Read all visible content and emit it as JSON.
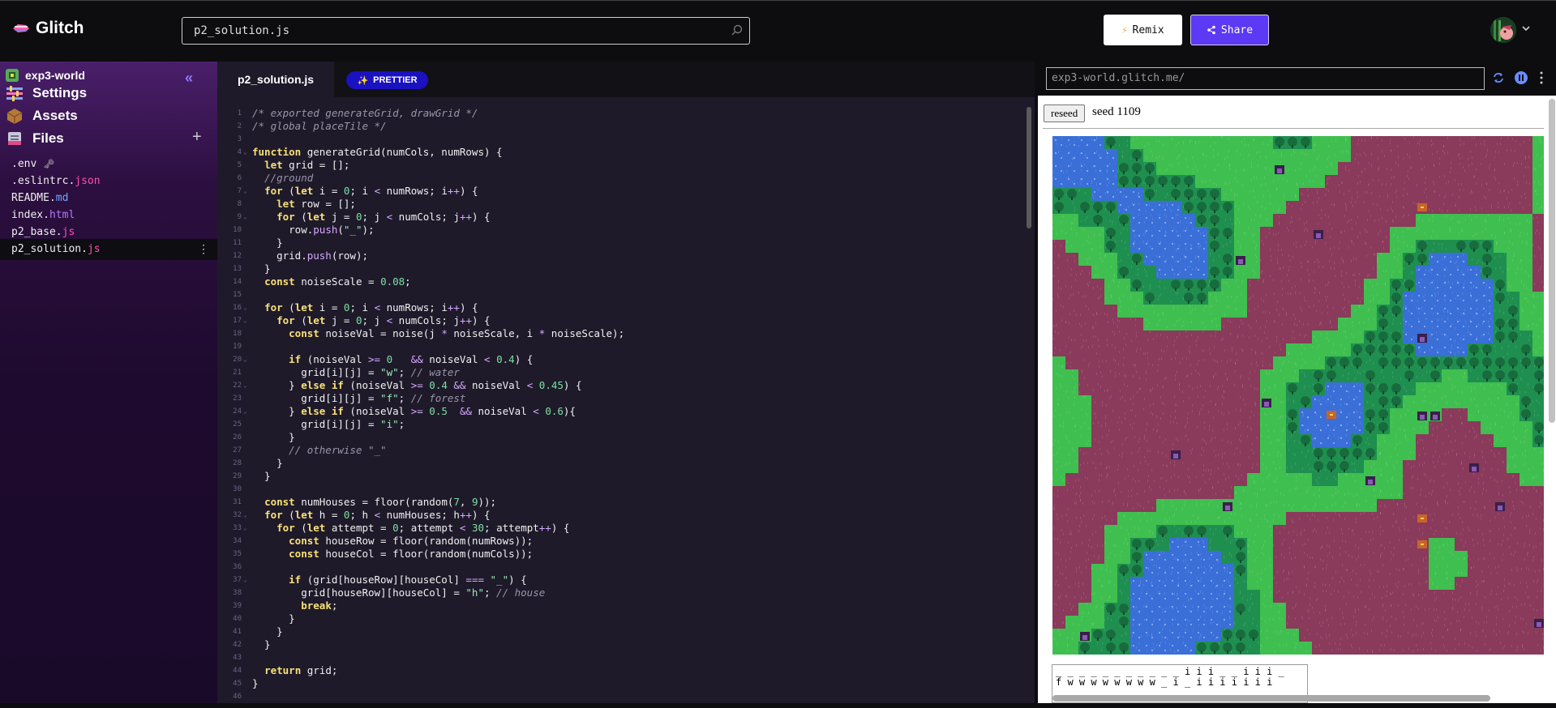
{
  "header": {
    "logo_text": "Glitch",
    "search_value": "p2_solution.js",
    "remix_label": "Remix",
    "share_label": "Share"
  },
  "sidebar": {
    "project_name": "exp3-world",
    "collapse_symbol": "«",
    "nav": {
      "settings": "Settings",
      "assets": "Assets",
      "files": "Files"
    },
    "add_symbol": "+",
    "files": [
      {
        "base": ".env",
        "ext": ""
      },
      {
        "base": ".eslintrc.",
        "ext": "json"
      },
      {
        "base": "README.",
        "ext": "md"
      },
      {
        "base": "index.",
        "ext": "html"
      },
      {
        "base": "p2_base.",
        "ext": "js"
      },
      {
        "base": "p2_solution.",
        "ext": "js"
      }
    ],
    "file_menu_symbol": "⋮"
  },
  "editor": {
    "tab_label": "p2_solution.js",
    "prettier_label": "PRETTIER",
    "line_numbers": [
      "1",
      "2",
      "3",
      "4",
      "5",
      "6",
      "7",
      "8",
      "9",
      "10",
      "11",
      "12",
      "13",
      "14",
      "15",
      "16",
      "17",
      "18",
      "19",
      "20",
      "21",
      "22",
      "23",
      "24",
      "25",
      "26",
      "27",
      "28",
      "29",
      "30",
      "31",
      "32",
      "33",
      "34",
      "35",
      "36",
      "37",
      "38",
      "39",
      "40",
      "41",
      "42",
      "43",
      "44",
      "45",
      "46"
    ],
    "code_lines": [
      [
        [
          "cm",
          "/* exported generateGrid, drawGrid */"
        ]
      ],
      [
        [
          "cm",
          "/* global placeTile */"
        ]
      ],
      [
        [
          "tx",
          ""
        ]
      ],
      [
        [
          "kw",
          "function"
        ],
        [
          "tx",
          " generateGrid(numCols, numRows) {"
        ]
      ],
      [
        [
          "tx",
          "  "
        ],
        [
          "kw",
          "let"
        ],
        [
          "tx",
          " grid = [];"
        ]
      ],
      [
        [
          "tx",
          "  "
        ],
        [
          "cm",
          "//ground"
        ]
      ],
      [
        [
          "tx",
          "  "
        ],
        [
          "kw",
          "for"
        ],
        [
          "tx",
          " ("
        ],
        [
          "kw",
          "let"
        ],
        [
          "tx",
          " i = "
        ],
        [
          "num",
          "0"
        ],
        [
          "tx",
          "; i "
        ],
        [
          "op",
          "<"
        ],
        [
          "tx",
          " numRows; i"
        ],
        [
          "op",
          "++"
        ],
        [
          "tx",
          ") {"
        ]
      ],
      [
        [
          "tx",
          "    "
        ],
        [
          "kw",
          "let"
        ],
        [
          "tx",
          " row = [];"
        ]
      ],
      [
        [
          "tx",
          "    "
        ],
        [
          "kw",
          "for"
        ],
        [
          "tx",
          " ("
        ],
        [
          "kw",
          "let"
        ],
        [
          "tx",
          " j = "
        ],
        [
          "num",
          "0"
        ],
        [
          "tx",
          "; j "
        ],
        [
          "op",
          "<"
        ],
        [
          "tx",
          " numCols; j"
        ],
        [
          "op",
          "++"
        ],
        [
          "tx",
          ") {"
        ]
      ],
      [
        [
          "tx",
          "      row."
        ],
        [
          "op",
          "push"
        ],
        [
          "tx",
          "("
        ],
        [
          "str",
          "\"_\""
        ],
        [
          "tx",
          ");"
        ]
      ],
      [
        [
          "tx",
          "    }"
        ]
      ],
      [
        [
          "tx",
          "    grid."
        ],
        [
          "op",
          "push"
        ],
        [
          "tx",
          "(row);"
        ]
      ],
      [
        [
          "tx",
          "  }"
        ]
      ],
      [
        [
          "tx",
          "  "
        ],
        [
          "kw",
          "const"
        ],
        [
          "tx",
          " noiseScale = "
        ],
        [
          "num",
          "0.08"
        ],
        [
          "tx",
          ";"
        ]
      ],
      [
        [
          "tx",
          ""
        ]
      ],
      [
        [
          "tx",
          "  "
        ],
        [
          "kw",
          "for"
        ],
        [
          "tx",
          " ("
        ],
        [
          "kw",
          "let"
        ],
        [
          "tx",
          " i = "
        ],
        [
          "num",
          "0"
        ],
        [
          "tx",
          "; i "
        ],
        [
          "op",
          "<"
        ],
        [
          "tx",
          " numRows; i"
        ],
        [
          "op",
          "++"
        ],
        [
          "tx",
          ") {"
        ]
      ],
      [
        [
          "tx",
          "    "
        ],
        [
          "kw",
          "for"
        ],
        [
          "tx",
          " ("
        ],
        [
          "kw",
          "let"
        ],
        [
          "tx",
          " j = "
        ],
        [
          "num",
          "0"
        ],
        [
          "tx",
          "; j "
        ],
        [
          "op",
          "<"
        ],
        [
          "tx",
          " numCols; j"
        ],
        [
          "op",
          "++"
        ],
        [
          "tx",
          ") {"
        ]
      ],
      [
        [
          "tx",
          "      "
        ],
        [
          "kw",
          "const"
        ],
        [
          "tx",
          " noiseVal = noise(j "
        ],
        [
          "op",
          "*"
        ],
        [
          "tx",
          " noiseScale, i "
        ],
        [
          "op",
          "*"
        ],
        [
          "tx",
          " noiseScale);"
        ]
      ],
      [
        [
          "tx",
          ""
        ]
      ],
      [
        [
          "tx",
          "      "
        ],
        [
          "kw",
          "if"
        ],
        [
          "tx",
          " (noiseVal "
        ],
        [
          "op",
          ">="
        ],
        [
          "tx",
          " "
        ],
        [
          "num",
          "0"
        ],
        [
          "tx",
          "   "
        ],
        [
          "op",
          "&&"
        ],
        [
          "tx",
          " noiseVal "
        ],
        [
          "op",
          "<"
        ],
        [
          "tx",
          " "
        ],
        [
          "num",
          "0.4"
        ],
        [
          "tx",
          ") {"
        ]
      ],
      [
        [
          "tx",
          "        grid[i][j] = "
        ],
        [
          "str",
          "\"w\""
        ],
        [
          "tx",
          "; "
        ],
        [
          "cm",
          "// water"
        ]
      ],
      [
        [
          "tx",
          "      } "
        ],
        [
          "kw",
          "else if"
        ],
        [
          "tx",
          " (noiseVal "
        ],
        [
          "op",
          ">="
        ],
        [
          "tx",
          " "
        ],
        [
          "num",
          "0.4"
        ],
        [
          "tx",
          " "
        ],
        [
          "op",
          "&&"
        ],
        [
          "tx",
          " noiseVal "
        ],
        [
          "op",
          "<"
        ],
        [
          "tx",
          " "
        ],
        [
          "num",
          "0.45"
        ],
        [
          "tx",
          ") {"
        ]
      ],
      [
        [
          "tx",
          "        grid[i][j] = "
        ],
        [
          "str",
          "\"f\""
        ],
        [
          "tx",
          "; "
        ],
        [
          "cm",
          "// forest"
        ]
      ],
      [
        [
          "tx",
          "      } "
        ],
        [
          "kw",
          "else if"
        ],
        [
          "tx",
          " (noiseVal "
        ],
        [
          "op",
          ">="
        ],
        [
          "tx",
          " "
        ],
        [
          "num",
          "0.5"
        ],
        [
          "tx",
          "  "
        ],
        [
          "op",
          "&&"
        ],
        [
          "tx",
          " noiseVal "
        ],
        [
          "op",
          "<"
        ],
        [
          "tx",
          " "
        ],
        [
          "num",
          "0.6"
        ],
        [
          "tx",
          "){"
        ]
      ],
      [
        [
          "tx",
          "        grid[i][j] = "
        ],
        [
          "str",
          "\"i\""
        ],
        [
          "tx",
          ";"
        ]
      ],
      [
        [
          "tx",
          "      }"
        ]
      ],
      [
        [
          "tx",
          "      "
        ],
        [
          "cm",
          "// otherwise \"_\""
        ]
      ],
      [
        [
          "tx",
          "    }"
        ]
      ],
      [
        [
          "tx",
          "  }"
        ]
      ],
      [
        [
          "tx",
          ""
        ]
      ],
      [
        [
          "tx",
          "  "
        ],
        [
          "kw",
          "const"
        ],
        [
          "tx",
          " numHouses = floor(random("
        ],
        [
          "num",
          "7"
        ],
        [
          "tx",
          ", "
        ],
        [
          "num",
          "9"
        ],
        [
          "tx",
          "));"
        ]
      ],
      [
        [
          "tx",
          "  "
        ],
        [
          "kw",
          "for"
        ],
        [
          "tx",
          " ("
        ],
        [
          "kw",
          "let"
        ],
        [
          "tx",
          " h = "
        ],
        [
          "num",
          "0"
        ],
        [
          "tx",
          "; h "
        ],
        [
          "op",
          "<"
        ],
        [
          "tx",
          " numHouses; h"
        ],
        [
          "op",
          "++"
        ],
        [
          "tx",
          ") {"
        ]
      ],
      [
        [
          "tx",
          "    "
        ],
        [
          "kw",
          "for"
        ],
        [
          "tx",
          " ("
        ],
        [
          "kw",
          "let"
        ],
        [
          "tx",
          " attempt = "
        ],
        [
          "num",
          "0"
        ],
        [
          "tx",
          "; attempt "
        ],
        [
          "op",
          "<"
        ],
        [
          "tx",
          " "
        ],
        [
          "num",
          "30"
        ],
        [
          "tx",
          "; attempt"
        ],
        [
          "op",
          "++"
        ],
        [
          "tx",
          ") {"
        ]
      ],
      [
        [
          "tx",
          "      "
        ],
        [
          "kw",
          "const"
        ],
        [
          "tx",
          " houseRow = floor(random(numRows));"
        ]
      ],
      [
        [
          "tx",
          "      "
        ],
        [
          "kw",
          "const"
        ],
        [
          "tx",
          " houseCol = floor(random(numCols));"
        ]
      ],
      [
        [
          "tx",
          ""
        ]
      ],
      [
        [
          "tx",
          "      "
        ],
        [
          "kw",
          "if"
        ],
        [
          "tx",
          " (grid[houseRow][houseCol] "
        ],
        [
          "op",
          "==="
        ],
        [
          "tx",
          " "
        ],
        [
          "str",
          "\"_\""
        ],
        [
          "tx",
          ") {"
        ]
      ],
      [
        [
          "tx",
          "        grid[houseRow][houseCol] = "
        ],
        [
          "str",
          "\"h\""
        ],
        [
          "tx",
          "; "
        ],
        [
          "cm",
          "// house"
        ]
      ],
      [
        [
          "tx",
          "        "
        ],
        [
          "kw",
          "break"
        ],
        [
          "tx",
          ";"
        ]
      ],
      [
        [
          "tx",
          "      }"
        ]
      ],
      [
        [
          "tx",
          "    }"
        ]
      ],
      [
        [
          "tx",
          "  }"
        ]
      ],
      [
        [
          "tx",
          ""
        ]
      ],
      [
        [
          "tx",
          "  "
        ],
        [
          "kw",
          "return"
        ],
        [
          "tx",
          " grid;"
        ]
      ],
      [
        [
          "tx",
          "}"
        ]
      ],
      [
        [
          "tx",
          ""
        ]
      ]
    ],
    "fold_lines": [
      4,
      7,
      9,
      16,
      17,
      20,
      22,
      24,
      32,
      33,
      37
    ]
  },
  "preview": {
    "url": "exp3-world.glitch.me/",
    "reseed_label": "reseed",
    "seed_text": "seed 1109",
    "ascii_lines": [
      "_ _ _ _ _ _ _ _ _ _ _ i i i _ _ i i i _",
      "f w w w w w w w w _ i _ i i i i i i i"
    ]
  },
  "colors": {
    "accent": "#5b39f5",
    "prettier": "#1a12c0",
    "water": "#3a6fd8",
    "forest": "#1f8f50",
    "grass": "#3fbf4f",
    "dirt": "#8a3a5a"
  },
  "icons": {
    "search": "search-icon",
    "remix": "lightning-icon",
    "share": "share-icon",
    "settings": "sliders-icon",
    "assets": "box-icon",
    "files": "files-icon"
  }
}
